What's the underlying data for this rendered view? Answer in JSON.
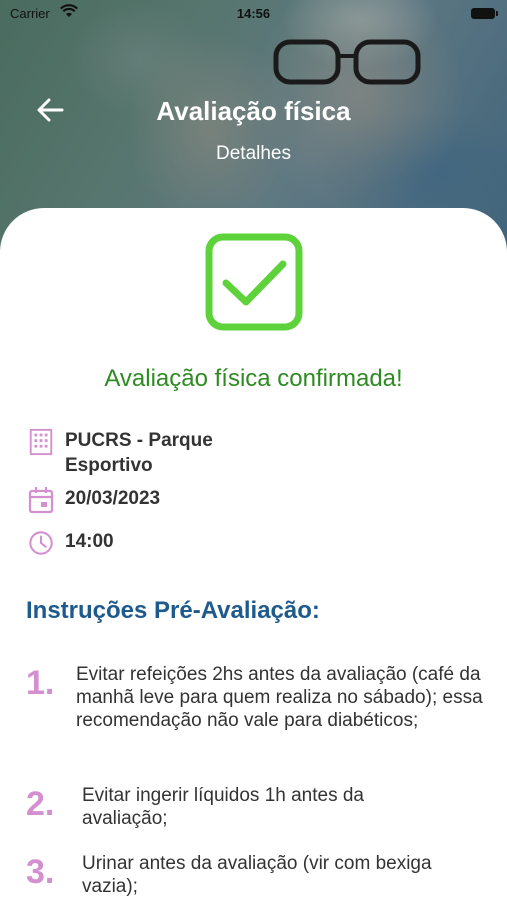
{
  "status_bar": {
    "carrier": "Carrier",
    "time": "14:56"
  },
  "header": {
    "title": "Avaliação física",
    "subtitle": "Detalhes"
  },
  "confirmation": {
    "message": "Avaliação física confirmada!"
  },
  "details": {
    "location": "PUCRS - Parque Esportivo",
    "date": "20/03/2023",
    "time": "14:00"
  },
  "instructions": {
    "title": "Instruções Pré-Avaliação:",
    "items": [
      {
        "number": "1.",
        "text": "Evitar refeições 2hs antes da avaliação (café da manhã leve para quem realiza no sábado); essa recomendação não vale para diabéticos;"
      },
      {
        "number": "2.",
        "text": "Evitar ingerir líquidos 1h antes da avaliação;"
      },
      {
        "number": "3.",
        "text": "Urinar antes da avaliação (vir com bexiga vazia);"
      }
    ]
  },
  "colors": {
    "accent_green": "#2e8b22",
    "check_green": "#5ed23a",
    "title_blue": "#1e5a8c",
    "icon_pink": "#d38fcf"
  }
}
